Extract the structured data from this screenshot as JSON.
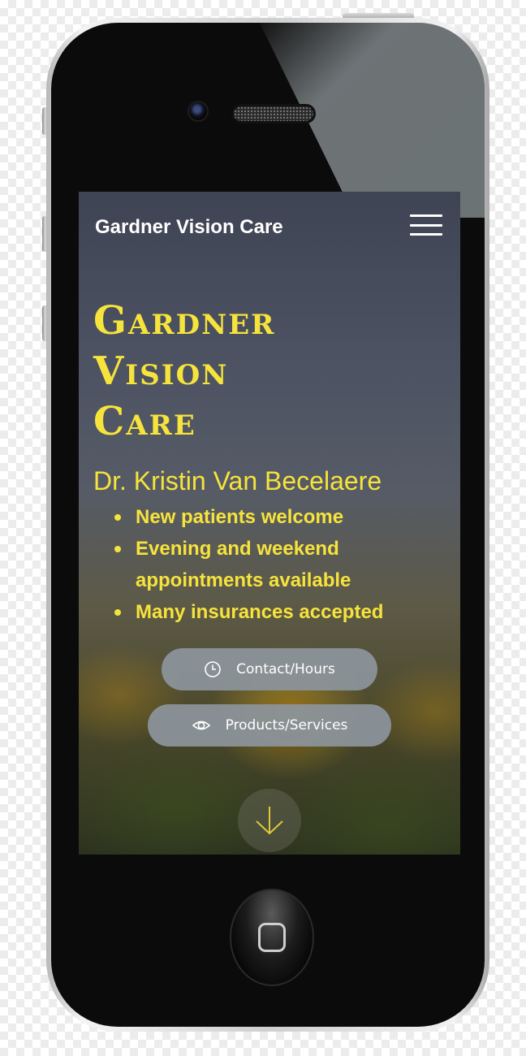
{
  "header": {
    "site_title": "Gardner Vision Care",
    "menu_icon": "hamburger-menu-icon"
  },
  "hero": {
    "title_lines": [
      "Gardner",
      "Vision",
      "Care"
    ],
    "doctor": "Dr. Kristin Van Becelaere",
    "features": [
      "New patients welcome",
      "Evening and weekend appointments available",
      "Many insurances accepted"
    ]
  },
  "buttons": {
    "contact_label": "Contact/Hours",
    "contact_icon": "clock-icon",
    "products_label": "Products/Services",
    "products_icon": "eye-icon"
  },
  "scroll": {
    "icon": "arrow-down-icon"
  },
  "colors": {
    "accent_yellow": "#f6e33c",
    "button_gray": "#8c949c",
    "header_text": "#ffffff"
  }
}
